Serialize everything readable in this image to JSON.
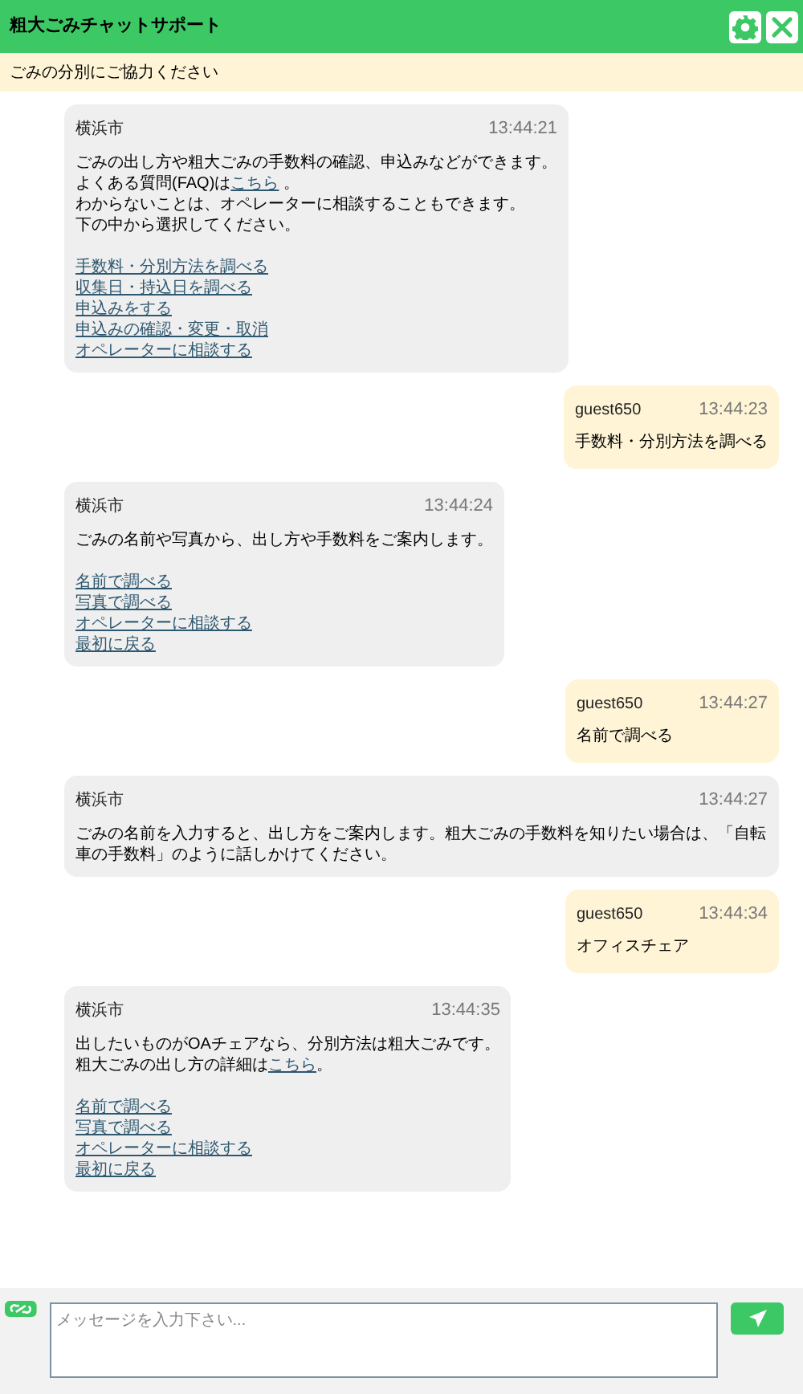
{
  "header": {
    "title": "粗大ごみチャットサポート"
  },
  "notice": "ごみの分別にご協力ください",
  "messages": [
    {
      "kind": "bot",
      "sender": "横浜市",
      "time": "13:44:21",
      "lines": [
        [
          {
            "text": "ごみの出し方や粗大ごみの手数料の確認、申込みなどができます。"
          }
        ],
        [
          {
            "text": "よくある質問(FAQ)は"
          },
          {
            "text": "こちら",
            "link": true
          },
          {
            "text": " 。"
          }
        ],
        [
          {
            "text": "わからないことは、オペレーターに相談することもできます。"
          }
        ],
        [
          {
            "text": "下の中から選択してください。"
          }
        ]
      ],
      "options": [
        "手数料・分別方法を調べる",
        "収集日・持込日を調べる",
        "申込みをする",
        "申込みの確認・変更・取消",
        "オペレーターに相談する"
      ]
    },
    {
      "kind": "user",
      "sender": "guest650",
      "time": "13:44:23",
      "lines": [
        [
          {
            "text": "手数料・分別方法を調べる"
          }
        ]
      ]
    },
    {
      "kind": "bot",
      "sender": "横浜市",
      "time": "13:44:24",
      "lines": [
        [
          {
            "text": "ごみの名前や写真から、出し方や手数料をご案内します。"
          }
        ]
      ],
      "options": [
        "名前で調べる",
        "写真で調べる",
        "オペレーターに相談する",
        "最初に戻る"
      ]
    },
    {
      "kind": "user",
      "sender": "guest650",
      "time": "13:44:27",
      "lines": [
        [
          {
            "text": "名前で調べる"
          }
        ]
      ]
    },
    {
      "kind": "bot",
      "sender": "横浜市",
      "time": "13:44:27",
      "lines": [
        [
          {
            "text": "ごみの名前を入力すると、出し方をご案内します。粗大ごみの手数料を知りたい場合は、「自転車の手数料」のように話しかけてください。"
          }
        ]
      ]
    },
    {
      "kind": "user",
      "sender": "guest650",
      "time": "13:44:34",
      "lines": [
        [
          {
            "text": "オフィスチェア"
          }
        ]
      ]
    },
    {
      "kind": "bot",
      "sender": "横浜市",
      "time": "13:44:35",
      "lines": [
        [
          {
            "text": "出したいものがOAチェアなら、分別方法は粗大ごみです。"
          }
        ],
        [
          {
            "text": "粗大ごみの出し方の詳細は"
          },
          {
            "text": "こちら",
            "link": true
          },
          {
            "text": "。"
          }
        ]
      ],
      "options": [
        "名前で調べる",
        "写真で調べる",
        "オペレーターに相談する",
        "最初に戻る"
      ]
    }
  ],
  "composer": {
    "placeholder": "メッセージを入力下さい..."
  }
}
